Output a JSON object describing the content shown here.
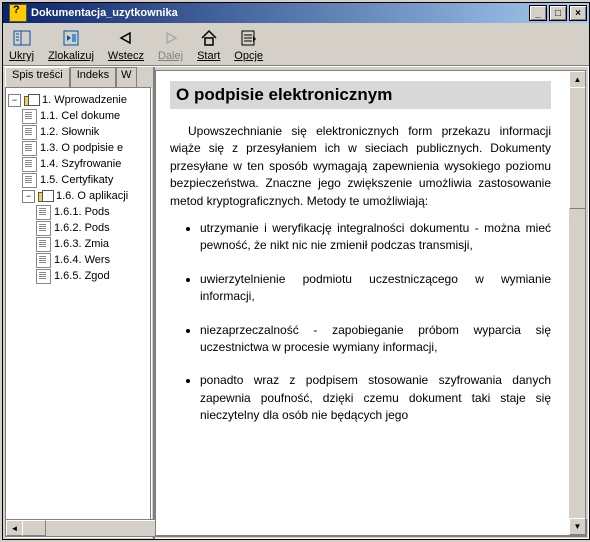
{
  "window": {
    "title": "Dokumentacja_uzytkownika"
  },
  "titlebtns": {
    "min": "_",
    "max": "□",
    "close": "×"
  },
  "toolbar": {
    "hide": {
      "label": "Ukryj"
    },
    "locate": {
      "label": "Zlokalizuj"
    },
    "back": {
      "label": "Wstecz"
    },
    "fwd": {
      "label": "Dalej"
    },
    "home": {
      "label": "Start"
    },
    "opts": {
      "label": "Opcje"
    }
  },
  "tabs": {
    "toc": "Spis treści",
    "index": "Indeks",
    "search": "W"
  },
  "tree": {
    "root": "1. Wprowadzenie",
    "n1": "1.1. Cel dokume",
    "n2": "1.2. Słownik",
    "n3": "1.3. O podpisie e",
    "n4": "1.4. Szyfrowanie",
    "n5": "1.5. Certyfikaty",
    "n6": "1.6. O aplikacji",
    "n61": "1.6.1. Pods",
    "n62": "1.6.2. Pods",
    "n63": "1.6.3. Zmia",
    "n64": "1.6.4. Wers",
    "n65": "1.6.5. Zgod"
  },
  "doc": {
    "title": "O podpisie elektronicznym",
    "para": "Upowszechnianie się elektronicznych form przekazu informacji wiąże się z przesyłaniem ich w sieciach publicznych. Dokumenty przesyłane w ten sposób wymagają zapewnienia wysokiego poziomu bezpieczeństwa. Znaczne jego zwiększenie umożliwia zastosowanie metod kryptograficznych. Metody te umożliwiają:",
    "li1": "utrzymanie i weryfikację integralności dokumentu - można mieć pewność, że nikt nic nie zmienił podczas transmisji,",
    "li2": "uwierzytelnienie podmiotu uczestniczącego w wymianie informacji,",
    "li3": "niezaprzeczalność - zapobieganie próbom wyparcia się uczestnictwa w procesie wymiany informacji,",
    "li4": "ponadto wraz z podpisem stosowanie szyfrowania danych zapewnia poufność, dzięki czemu dokument taki staje się nieczytelny dla osób nie będących jego"
  }
}
